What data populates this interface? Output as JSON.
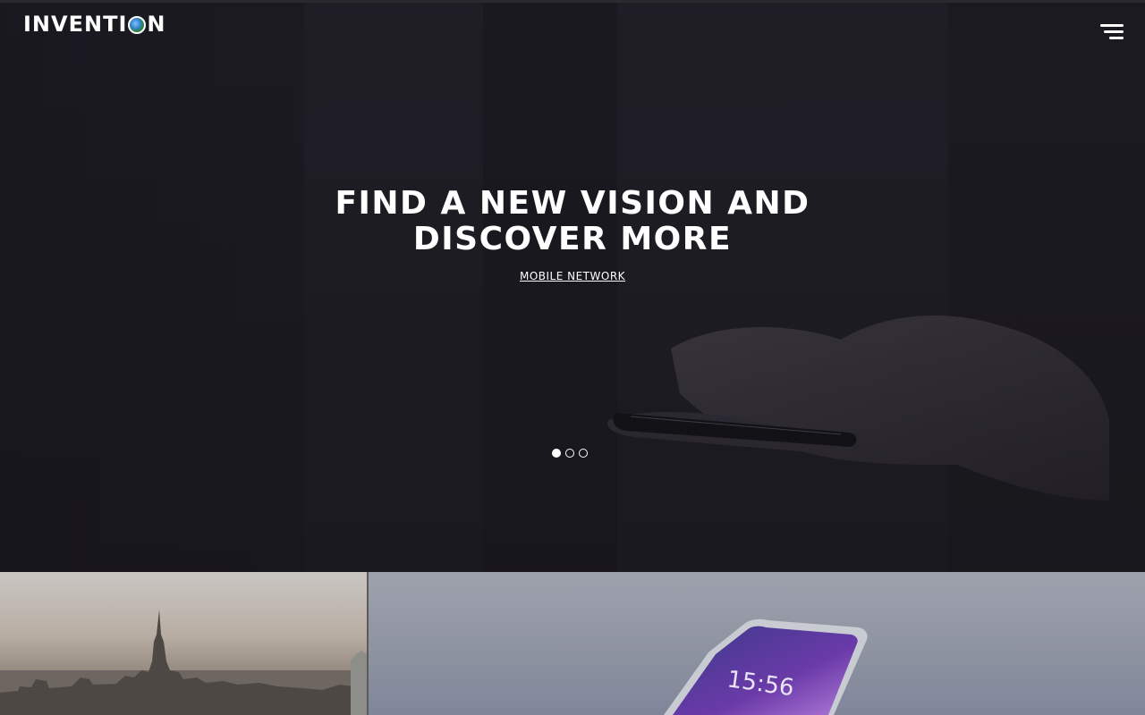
{
  "brand": {
    "name_prefix": "INVENTI",
    "name_suffix": "N"
  },
  "hero": {
    "title_line1": "FIND A NEW VISION AND",
    "title_line2": "DISCOVER MORE",
    "link_label": "MOBILE NETWORK",
    "slides": {
      "count": 3,
      "active_index": 0
    }
  },
  "tiles": [
    {
      "name": "city-skyline-image"
    },
    {
      "name": "smartphone-lockscreen-image",
      "clock_text": "15:56"
    }
  ]
}
